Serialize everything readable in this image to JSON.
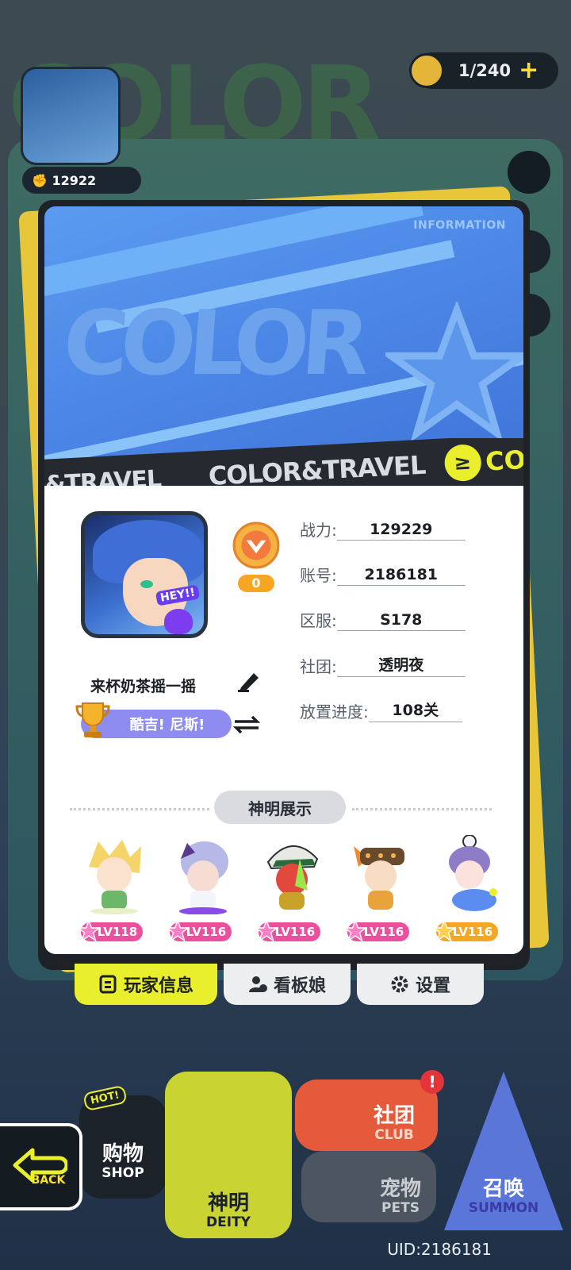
{
  "top_bar": {
    "energy": "1/240",
    "energy_plus": "+",
    "power_partial": "12922"
  },
  "modal": {
    "banner_tag": "INFORMATION",
    "banner_word": "COLOR",
    "ribbon_left": "&TRAVEL",
    "ribbon_main": "COLOR&TRAVEL",
    "ribbon_end": "CO",
    "avatar_tag": "HEY!!",
    "rank_value": "0",
    "nickname": "来杯奶茶摇一摇",
    "title_badge": "酷吉! 尼斯!",
    "info": [
      {
        "label": "战力:",
        "value": "129229"
      },
      {
        "label": "账号:",
        "value": "2186181"
      },
      {
        "label": "区服:",
        "value": "S178"
      },
      {
        "label": "社团:",
        "value": "透明夜"
      },
      {
        "label": "放置进度:",
        "value": "108关"
      }
    ],
    "section_title": "神明展示",
    "deities": [
      {
        "level": "LV118",
        "color": "#ec4f9e"
      },
      {
        "level": "LV116",
        "color": "#ec4f9e"
      },
      {
        "level": "LV116",
        "color": "#ec4f9e"
      },
      {
        "level": "LV116",
        "color": "#ec4f9e"
      },
      {
        "level": "LV116",
        "color": "#f5a623"
      }
    ]
  },
  "tabs": [
    {
      "label": "玩家信息",
      "active": true
    },
    {
      "label": "看板娘",
      "active": false
    },
    {
      "label": "设置",
      "active": false
    }
  ],
  "bottom_nav": {
    "back": "BACK",
    "shop_label": "购物",
    "shop_sub": "SHOP",
    "shop_badge": "HOT!",
    "deity_label": "神明",
    "deity_sub": "DEITY",
    "club_label": "社团",
    "club_sub": "CLUB",
    "pets_label": "宠物",
    "pets_sub": "PETS",
    "summon_label": "召唤",
    "summon_sub": "SUMMON",
    "alert": "!"
  },
  "uid": "UID:2186181",
  "colors": {
    "accent_yellow": "#e9ef2c",
    "banner_blue": "#4c86e6",
    "lv_pink": "#ec4f9e",
    "lv_gold": "#f5a623"
  }
}
